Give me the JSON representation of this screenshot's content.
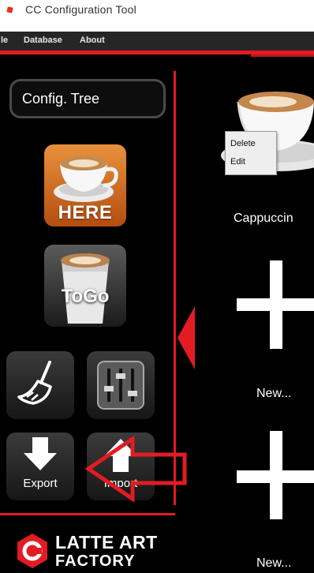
{
  "window": {
    "title": "CC Configuration Tool",
    "app_icon": "app-icon"
  },
  "menubar": {
    "items": [
      "le",
      "Database",
      "About"
    ]
  },
  "sidebar": {
    "config_tree_label": "Config. Tree",
    "here_label": "HERE",
    "togo_label": "ToGo",
    "clean_icon": "broom-icon",
    "settings_icon": "sliders-icon",
    "export_label": "Export",
    "import_label": "Import",
    "logo_line1": "LATTE ART",
    "logo_line2": "FACTORY"
  },
  "main": {
    "items": [
      {
        "label": "Cappuccin",
        "icon": "cappuccino-cup-icon"
      },
      {
        "label": "New...",
        "icon": "plus-icon"
      },
      {
        "label": "New...",
        "icon": "plus-icon"
      }
    ],
    "context_menu": {
      "items": [
        "Delete",
        "Edit"
      ]
    }
  },
  "colors": {
    "accent_red": "#e31b23",
    "here_orange": "#d9731f",
    "background": "#000000"
  }
}
